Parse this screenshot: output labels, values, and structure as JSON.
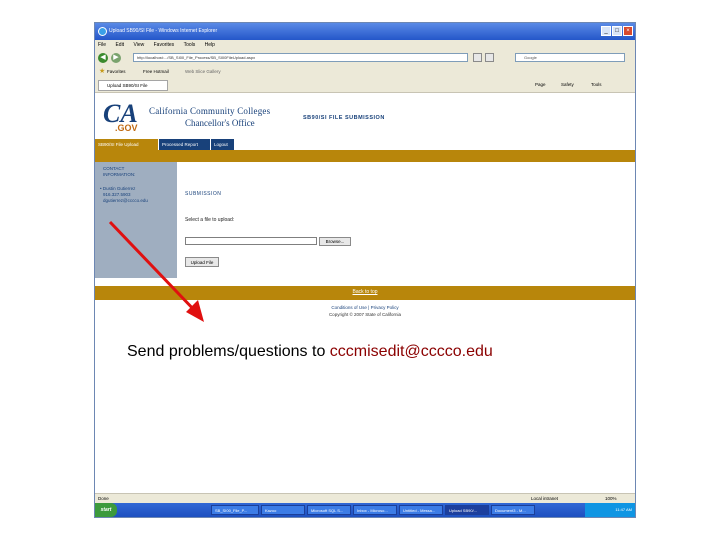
{
  "window": {
    "title": "Upload SB90/SI File - Windows Internet Explorer",
    "controls": {
      "minimize": "_",
      "maximize": "□",
      "close": "×"
    }
  },
  "menu": [
    "File",
    "Edit",
    "View",
    "Favorites",
    "Tools",
    "Help"
  ],
  "address": {
    "url": "http://localhost:.../SB_SI00_File_Process/SB_SI00FileUpload.aspx",
    "search_placeholder": "Google"
  },
  "favorites_bar": {
    "label": "Favorites",
    "items": [
      "Free Hotmail",
      "Web Slice Gallery"
    ]
  },
  "browser_tab": {
    "label": "Upload SB90/SI File"
  },
  "command_bar": [
    "Page",
    "Safety",
    "Tools"
  ],
  "site": {
    "logo_text": "CA",
    "logo_gov": ".GOV",
    "org_line1": "California Community Colleges",
    "org_line2": "Chancellor's Office",
    "page_title": "SB90/SI FILE SUBMISSION",
    "nav_tabs": [
      {
        "label": "SB90/SI File Upload",
        "active": true
      },
      {
        "label": "Processed Report",
        "active": false
      },
      {
        "label": "Logout",
        "active": false
      }
    ],
    "sidebar": {
      "heading_line1": "CONTACT",
      "heading_line2": "INFORMATION:",
      "contact_name": "• Dustin Gutierrez",
      "contact_phone": "916.327.5903",
      "contact_email": "dgutierrez@cccco.edu"
    },
    "upload": {
      "heading": "SUBMISSION",
      "label": "Select a file to upload:",
      "browse_label": "Browse...",
      "upload_label": "Upload File"
    },
    "back_to_top": "Back to top",
    "footer_links": "Conditions of Use | Privacy Policy",
    "copyright": "Copyright © 2007 State of California"
  },
  "status_bar": {
    "text": "Done",
    "zone": "Local intranet",
    "zoom": "100%"
  },
  "taskbar": {
    "start": "start",
    "buttons": [
      "SB_SI00_File_P...",
      "Kazoo",
      "Microsoft SQL S...",
      "Inbox - Microso...",
      "Untitled - Messa...",
      "Upload SB90/...",
      "Document3 - M..."
    ],
    "active_index": 5,
    "clock": "11:47 AM"
  },
  "annotation": {
    "message_prefix": "Send problems/questions to ",
    "email": "cccmisedit@cccco.edu",
    "arrow_color": "#e01010"
  }
}
